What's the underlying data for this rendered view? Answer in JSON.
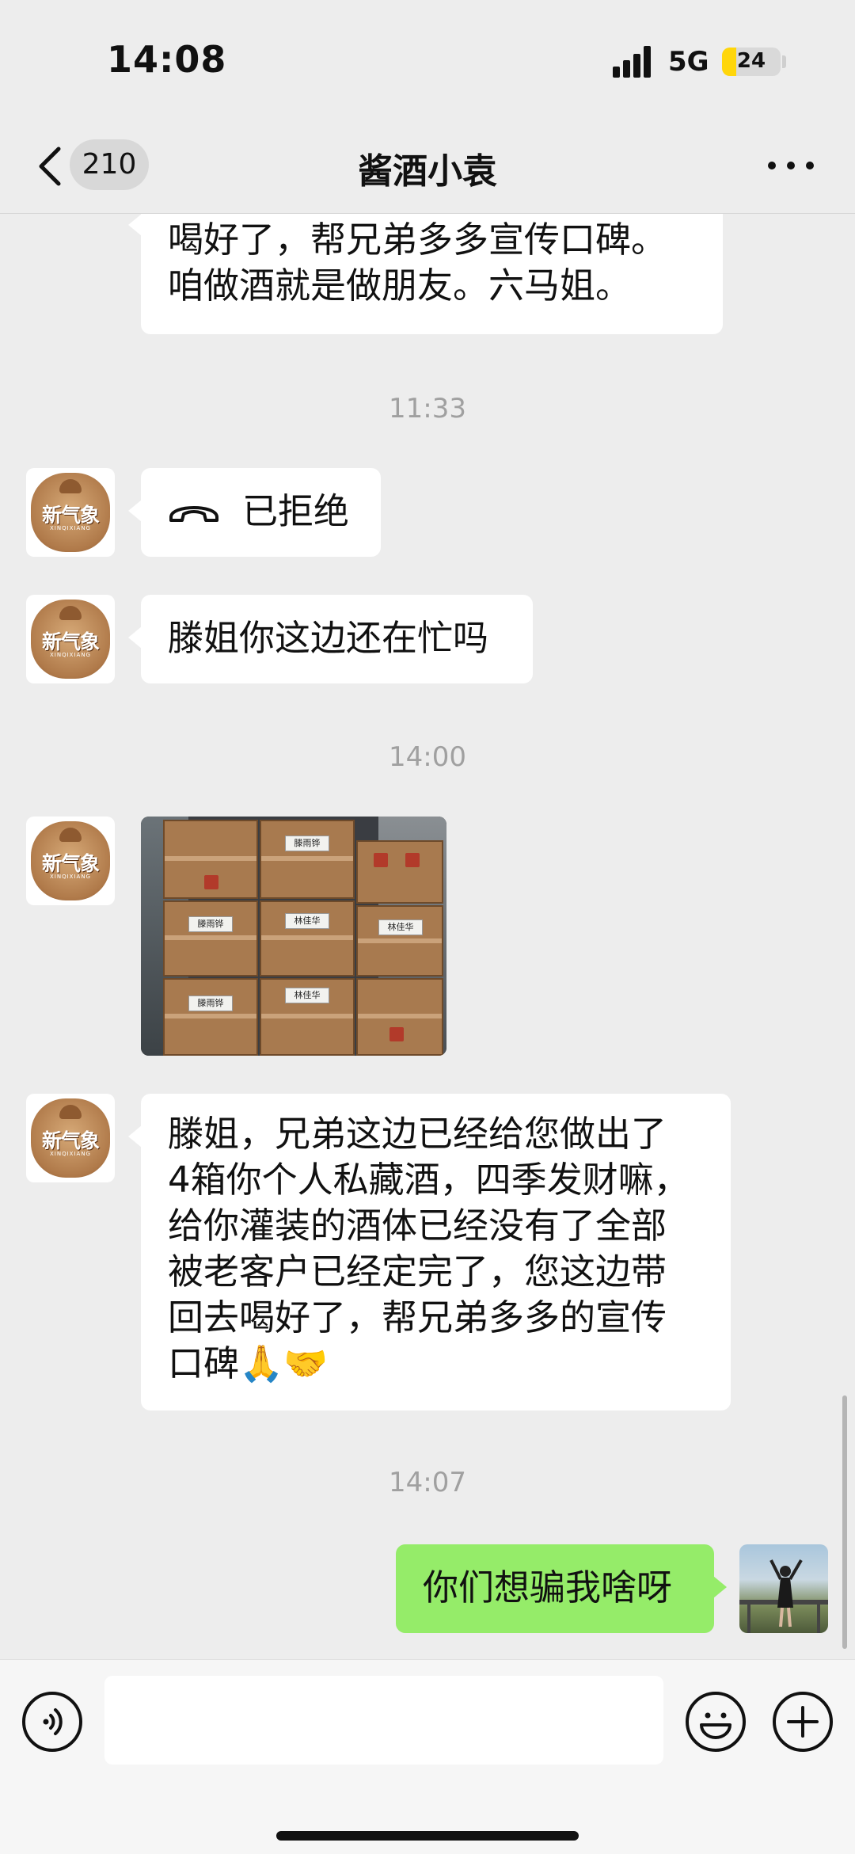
{
  "status_bar": {
    "time": "14:08",
    "network": "5G",
    "battery": "24",
    "battery_level": 0.24
  },
  "nav": {
    "unread_count": "210",
    "title": "酱酒小袁"
  },
  "avatars": {
    "contact_logo_text": "新气象",
    "contact_logo_sub": "XINQIXIANG"
  },
  "messages": {
    "partial_top_line1": "喝好了，帮兄弟多多宣传口碑。",
    "partial_top_line2": "咱做酒就是做朋友。六马姐。",
    "time_1": "11:33",
    "call_status": "已拒绝",
    "text_1": "滕姐你这边还在忙吗",
    "time_2": "14:00",
    "box_tags": [
      "滕雨铧",
      "滕雨铧",
      "林佳华",
      "滕雨铧",
      "林佳华",
      "林佳华"
    ],
    "long_text_lines": [
      "滕姐，兄弟这边已经给您做出了",
      "4箱你个人私藏酒，四季发财嘛，",
      "给你灌装的酒体已经没有了全部",
      "被老客户已经定完了，您这边带",
      "回去喝好了，帮兄弟多多的宣传",
      "口碑"
    ],
    "long_text_emoji": "🙏🤝",
    "time_3": "14:07",
    "my_reply": "你们想骗我啥呀"
  },
  "colors": {
    "background": "#EDEDED",
    "sent_bubble": "#95EC69",
    "received_bubble": "#FFFFFF",
    "timestamp": "#A0A0A0"
  }
}
